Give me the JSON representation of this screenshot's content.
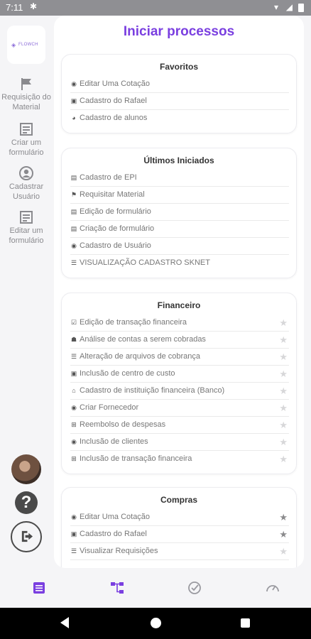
{
  "statusbar": {
    "time": "7:11"
  },
  "sidebar": {
    "logo_text": "FLOWCH",
    "items": [
      {
        "label": "Requisição do Material"
      },
      {
        "label": "Criar um formulário"
      },
      {
        "label": "Cadastrar Usuário"
      },
      {
        "label": "Editar um formulário"
      }
    ]
  },
  "main": {
    "title": "Iniciar processos"
  },
  "cards": [
    {
      "title": "Favoritos",
      "rows": [
        {
          "label": "Editar Uma Cotação",
          "icon": "eye-icon"
        },
        {
          "label": "Cadastro do Rafael",
          "icon": "cog-icon"
        },
        {
          "label": "Cadastro de alunos",
          "icon": "pie-icon"
        }
      ]
    },
    {
      "title": "Últimos Iniciados",
      "rows": [
        {
          "label": "Cadastro de EPI",
          "icon": "doc-icon"
        },
        {
          "label": "Requisitar Material",
          "icon": "flag-icon"
        },
        {
          "label": "Edição de formulário",
          "icon": "form-icon"
        },
        {
          "label": "Criação de formulário",
          "icon": "form-icon"
        },
        {
          "label": "Cadastro de Usuário",
          "icon": "user-icon"
        },
        {
          "label": "VISUALIZAÇÃO CADASTRO SKNET",
          "icon": "list-icon"
        }
      ]
    },
    {
      "title": "Financeiro",
      "rows": [
        {
          "label": "Edição de transação financeira",
          "icon": "check-icon",
          "starred": false
        },
        {
          "label": "Análise de contas a serem cobradas",
          "icon": "user-tie-icon",
          "starred": false
        },
        {
          "label": "Alteração de arquivos de cobrança",
          "icon": "list-icon",
          "starred": false
        },
        {
          "label": "Inclusão de centro de custo",
          "icon": "money-icon",
          "starred": false
        },
        {
          "label": "Cadastro de instituição financeira (Banco)",
          "icon": "bank-icon",
          "starred": false
        },
        {
          "label": "Criar Fornecedor",
          "icon": "eye-icon",
          "starred": false
        },
        {
          "label": "Reembolso de despesas",
          "icon": "grid-icon",
          "starred": false
        },
        {
          "label": "Inclusão de clientes",
          "icon": "eye-icon",
          "starred": false
        },
        {
          "label": "Inclusão de transação financeira",
          "icon": "grid-icon",
          "starred": false
        }
      ]
    },
    {
      "title": "Compras",
      "rows": [
        {
          "label": "Editar Uma Cotação",
          "icon": "eye-icon",
          "starred": true
        },
        {
          "label": "Cadastro do Rafael",
          "icon": "cog-icon",
          "starred": true
        },
        {
          "label": "Visualizar Requisições",
          "icon": "list-icon",
          "starred": false
        }
      ]
    }
  ],
  "colors": {
    "accent": "#7a3fe0",
    "nav_inactive": "#9a9aa0"
  },
  "bottom_nav": [
    {
      "name": "forms-tab",
      "icon": "list-icon",
      "active": false
    },
    {
      "name": "processes-tab",
      "icon": "flow-icon",
      "active": true
    },
    {
      "name": "tasks-tab",
      "icon": "check-circle-icon",
      "active": false
    },
    {
      "name": "dashboard-tab",
      "icon": "gauge-icon",
      "active": false
    }
  ]
}
